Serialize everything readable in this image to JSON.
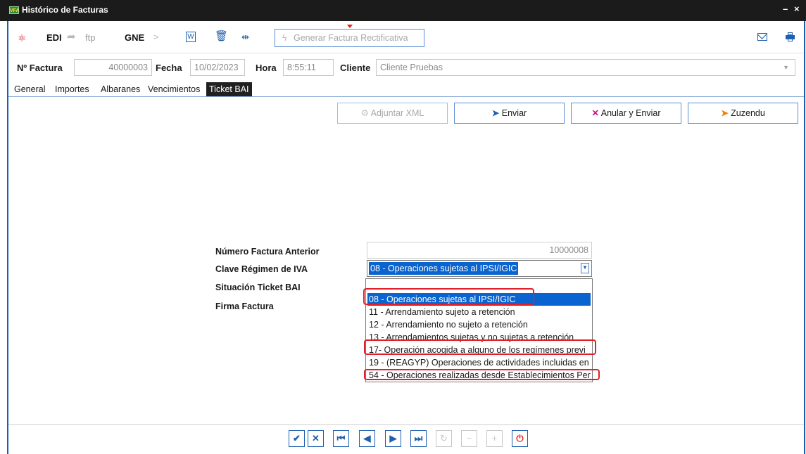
{
  "window": {
    "logo_text": "VFA",
    "title": "Histórico de Facturas",
    "minimize": "–",
    "close": "×"
  },
  "toolbar": {
    "edi": "EDI",
    "ftp": "ftp",
    "gne": "GNE",
    "generate_rect_label": "Generar Factura Rectificativa",
    "icons": [
      "atom-icon",
      "export-icon",
      "send-icon",
      "word-icon",
      "trash-icon",
      "code-icon",
      "lightning-icon",
      "mail-icon",
      "print-icon"
    ]
  },
  "header": {
    "factura_label": "Nº Factura",
    "factura_value": "40000003",
    "fecha_label": "Fecha",
    "fecha_value": "10/02/2023",
    "hora_label": "Hora",
    "hora_value": "8:55:11",
    "cliente_label": "Cliente",
    "cliente_value": "Cliente Pruebas"
  },
  "tabs": [
    "General",
    "Importes",
    "Albaranes",
    "Vencimientos",
    "Ticket BAI"
  ],
  "active_tab": "Ticket BAI",
  "actions": {
    "adjuntar": "Adjuntar XML",
    "enviar": "Enviar",
    "anular": "Anular y Enviar",
    "zuzendu": "Zuzendu"
  },
  "form": {
    "numero_label": "Número Factura Anterior",
    "numero_value": "10000008",
    "clave_label": "Clave Régimen de IVA",
    "clave_value": "08 - Operaciones sujetas al IPSI/IGIC",
    "situacion_label": "Situación Ticket BAI",
    "firma_label": "Firma Factura"
  },
  "dropdown": {
    "options": [
      "",
      "08 - Operaciones sujetas al IPSI/IGIC",
      "11 - Arrendamiento sujeto a retención",
      "12 - Arrendamiento no sujeto a retención",
      "13 - Arrendamientos sujetas y no sujetas a retención",
      "17- Operación acogida a alguno de los regímenes previ",
      "19 - (REAGYP) Operaciones de actividades incluidas en",
      "54 - Operaciones realizadas desde Establecimientos Per"
    ],
    "selected_index": 1
  },
  "colors": {
    "accent": "#1f5fae",
    "selection": "#0a64cf",
    "highlight": "#e0202a",
    "titlebar": "#1b1b1b"
  }
}
